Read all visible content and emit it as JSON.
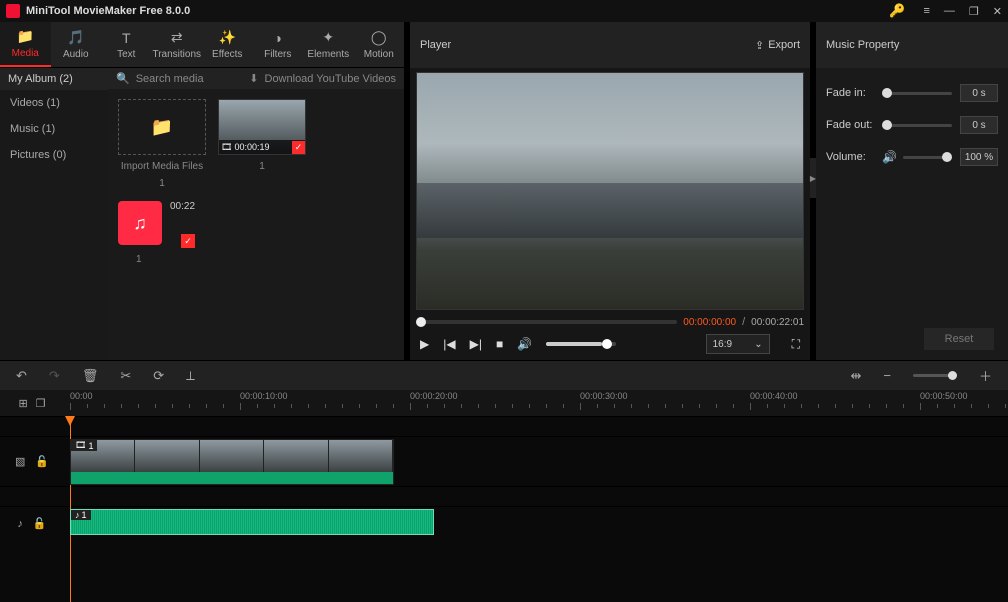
{
  "app": {
    "title": "MiniTool MovieMaker Free 8.0.0"
  },
  "tabs": [
    {
      "key": "media",
      "label": "Media",
      "icon": "📁",
      "active": true
    },
    {
      "key": "audio",
      "label": "Audio",
      "icon": "🎵",
      "active": false
    },
    {
      "key": "text",
      "label": "Text",
      "icon": "T",
      "active": false
    },
    {
      "key": "transitions",
      "label": "Transitions",
      "icon": "⇄",
      "active": false
    },
    {
      "key": "effects",
      "label": "Effects",
      "icon": "✨",
      "active": false
    },
    {
      "key": "filters",
      "label": "Filters",
      "icon": "◑",
      "active": false
    },
    {
      "key": "elements",
      "label": "Elements",
      "icon": "✦",
      "active": false
    },
    {
      "key": "motion",
      "label": "Motion",
      "icon": "◯",
      "active": false
    }
  ],
  "library": {
    "album": "My Album (2)",
    "categories": [
      {
        "label": "Videos (1)"
      },
      {
        "label": "Music (1)"
      },
      {
        "label": "Pictures (0)"
      }
    ],
    "search_placeholder": "Search media",
    "download_label": "Download YouTube Videos",
    "import_label": "Import Media Files",
    "import_count": "1",
    "video_clip": {
      "duration": "00:00:19",
      "count": "1"
    },
    "music_clip": {
      "duration": "00:22",
      "count": "1"
    }
  },
  "player": {
    "title": "Player",
    "export_label": "Export",
    "time_current": "00:00:00:00",
    "time_total": "00:00:22:01",
    "aspect": "16:9"
  },
  "props": {
    "title": "Music Property",
    "fade_in": {
      "label": "Fade in:",
      "value": "0 s"
    },
    "fade_out": {
      "label": "Fade out:",
      "value": "0 s"
    },
    "volume": {
      "label": "Volume:",
      "value": "100 %"
    },
    "reset": "Reset"
  },
  "timeline": {
    "ruler_labels": [
      "00:00",
      "00:00:10:00",
      "00:00:20:00",
      "00:00:30:00",
      "00:00:40:00",
      "00:00:50:00"
    ],
    "video_clip_label": "1",
    "audio_clip_label": "1"
  }
}
